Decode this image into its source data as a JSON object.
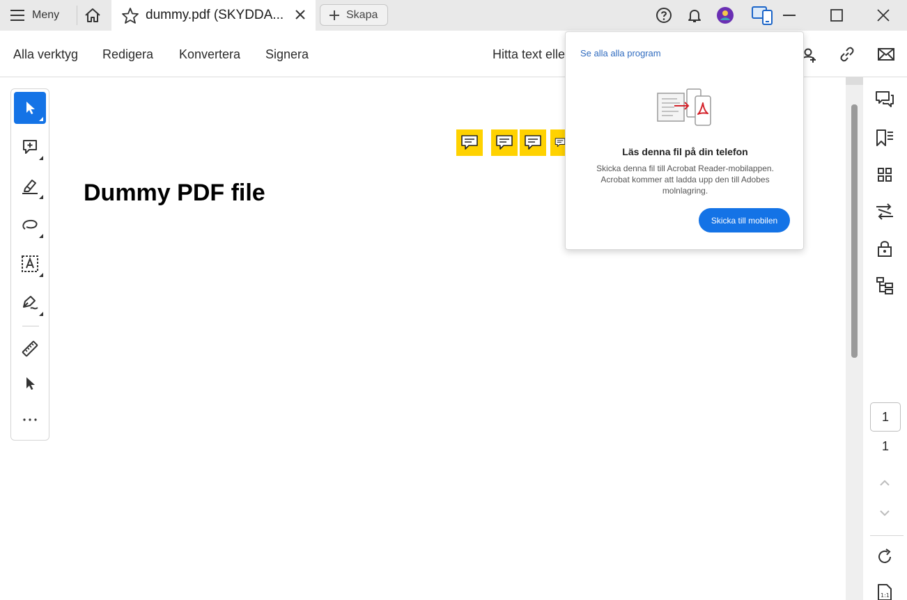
{
  "titlebar": {
    "menu_label": "Meny",
    "tab_title": "dummy.pdf (SKYDDA...",
    "create_label": "Skapa",
    "icons": [
      "help-icon",
      "bell-icon",
      "avatar",
      "mobile-devices-icon",
      "minimize-icon",
      "maximize-icon",
      "close-icon"
    ]
  },
  "toolbar": {
    "items": [
      "Alla verktyg",
      "Redigera",
      "Konvertera",
      "Signera"
    ],
    "search_text": "Hitta text elle",
    "right_icons": [
      "share-user-icon",
      "link-icon",
      "mail-icon"
    ]
  },
  "tools": [
    "select-pointer-icon",
    "add-comment-icon",
    "highlight-icon",
    "draw-shape-icon",
    "text-box-icon",
    "sign-pen-icon",
    "measure-ruler-icon",
    "arrow-pointer-icon",
    "more-icon"
  ],
  "document": {
    "heading": "Dummy PDF file",
    "comment_note_count": 4
  },
  "popover": {
    "see_all": "Se alla alla program",
    "title": "Läs denna fil på din telefon",
    "body": "Skicka denna fil till Acrobat Reader-mobilappen. Acrobat kommer att ladda upp den till Adobes molnlagring.",
    "button": "Skicka till mobilen"
  },
  "right_rail": {
    "icons": [
      "comments-icon",
      "bookmarks-icon",
      "thumbnails-icon",
      "compare-icon",
      "protect-icon",
      "structure-icon"
    ],
    "page_current": "1",
    "page_total": "1",
    "bottom_icons": [
      "rotate-icon",
      "actual-size-icon"
    ]
  },
  "colors": {
    "accent": "#1473e6",
    "note_yellow": "#ffd200",
    "titlebar_bg": "#e9e9e9",
    "link": "#2f6bbf"
  }
}
